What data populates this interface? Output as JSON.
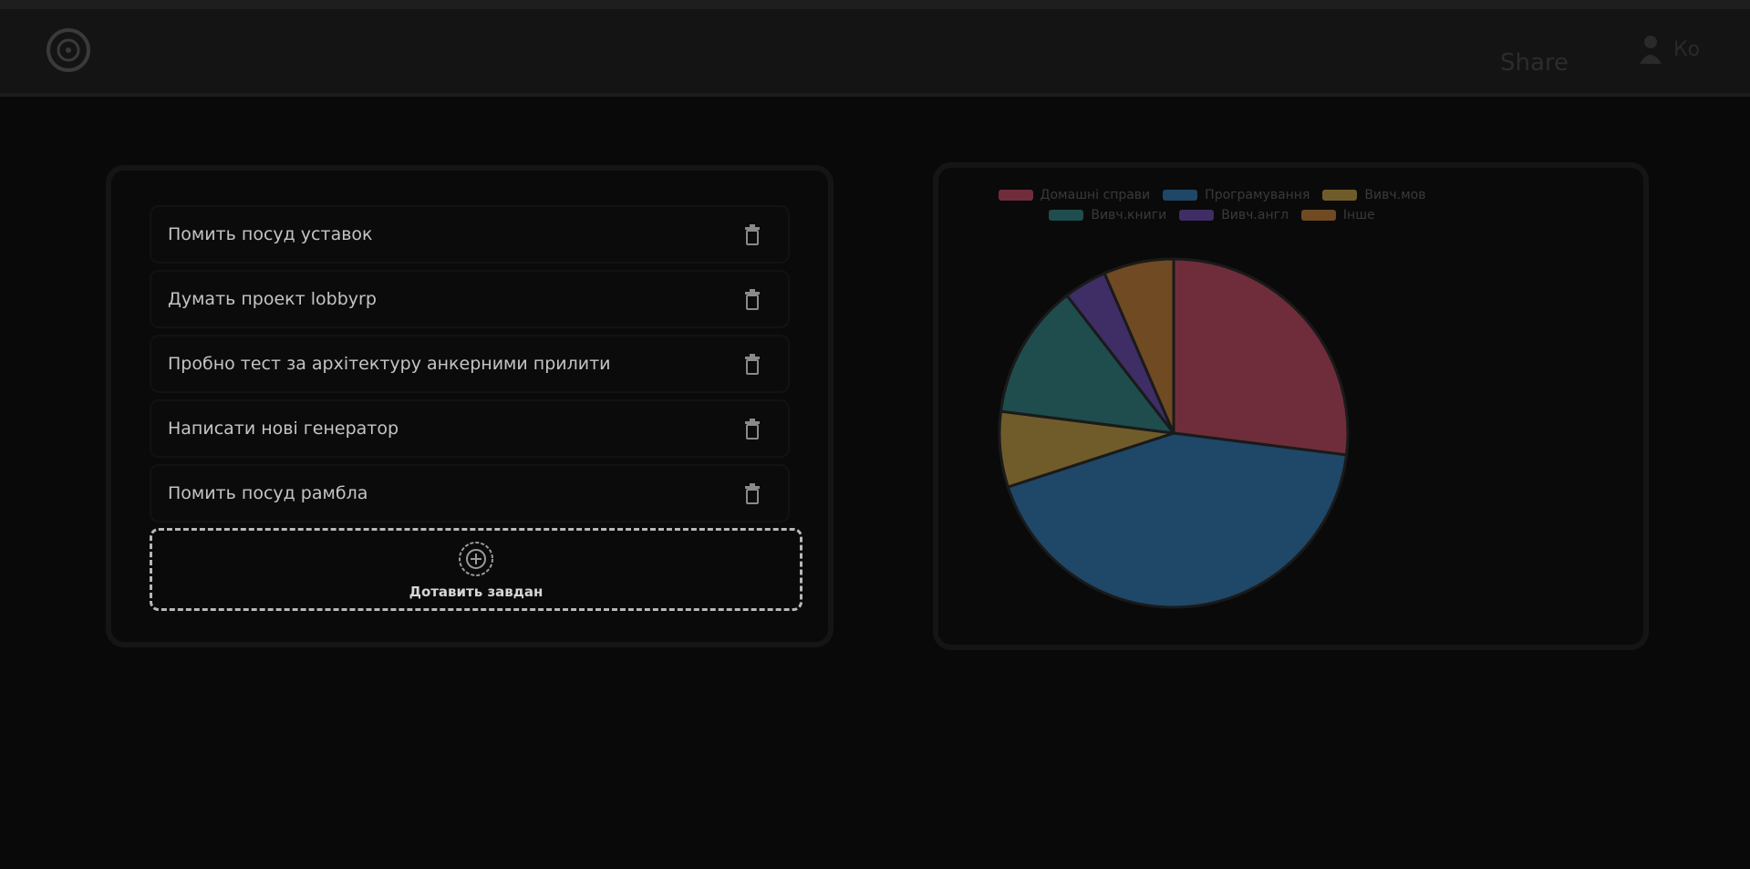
{
  "header": {
    "logo_icon": "logo-circle-icon",
    "share_label": "Share",
    "user_icon": "user-icon",
    "user_name": "Ко"
  },
  "tasks": {
    "items": [
      {
        "text": "Помить посуд уставок",
        "action_icon": "trash-icon"
      },
      {
        "text": "Думать проект lobbyrр",
        "action_icon": "trash-icon"
      },
      {
        "text": "Пробно тест за архітектуру анкерними прилити",
        "action_icon": "trash-icon"
      },
      {
        "text": "Написати нові генератор",
        "action_icon": "trash-icon"
      },
      {
        "text": "Помить посуд рамбла",
        "action_icon": "trash-icon"
      }
    ],
    "add_label": "Дотавить завдан",
    "add_icon": "plus-circle-icon"
  },
  "chart_data": {
    "type": "pie",
    "series": [
      {
        "name": "Домашні справи",
        "value": 27,
        "color": "#6f2d3b"
      },
      {
        "name": "Програмування",
        "value": 43,
        "color": "#1f4767"
      },
      {
        "name": "Вивч.мов",
        "value": 7,
        "color": "#705c2b"
      },
      {
        "name": "Вивч.книги",
        "value": 12.5,
        "color": "#1f4d4d"
      },
      {
        "name": "Вивч.англ",
        "value": 4,
        "color": "#3f2d66"
      },
      {
        "name": "Інше",
        "value": 6.5,
        "color": "#6f4a22"
      }
    ]
  }
}
